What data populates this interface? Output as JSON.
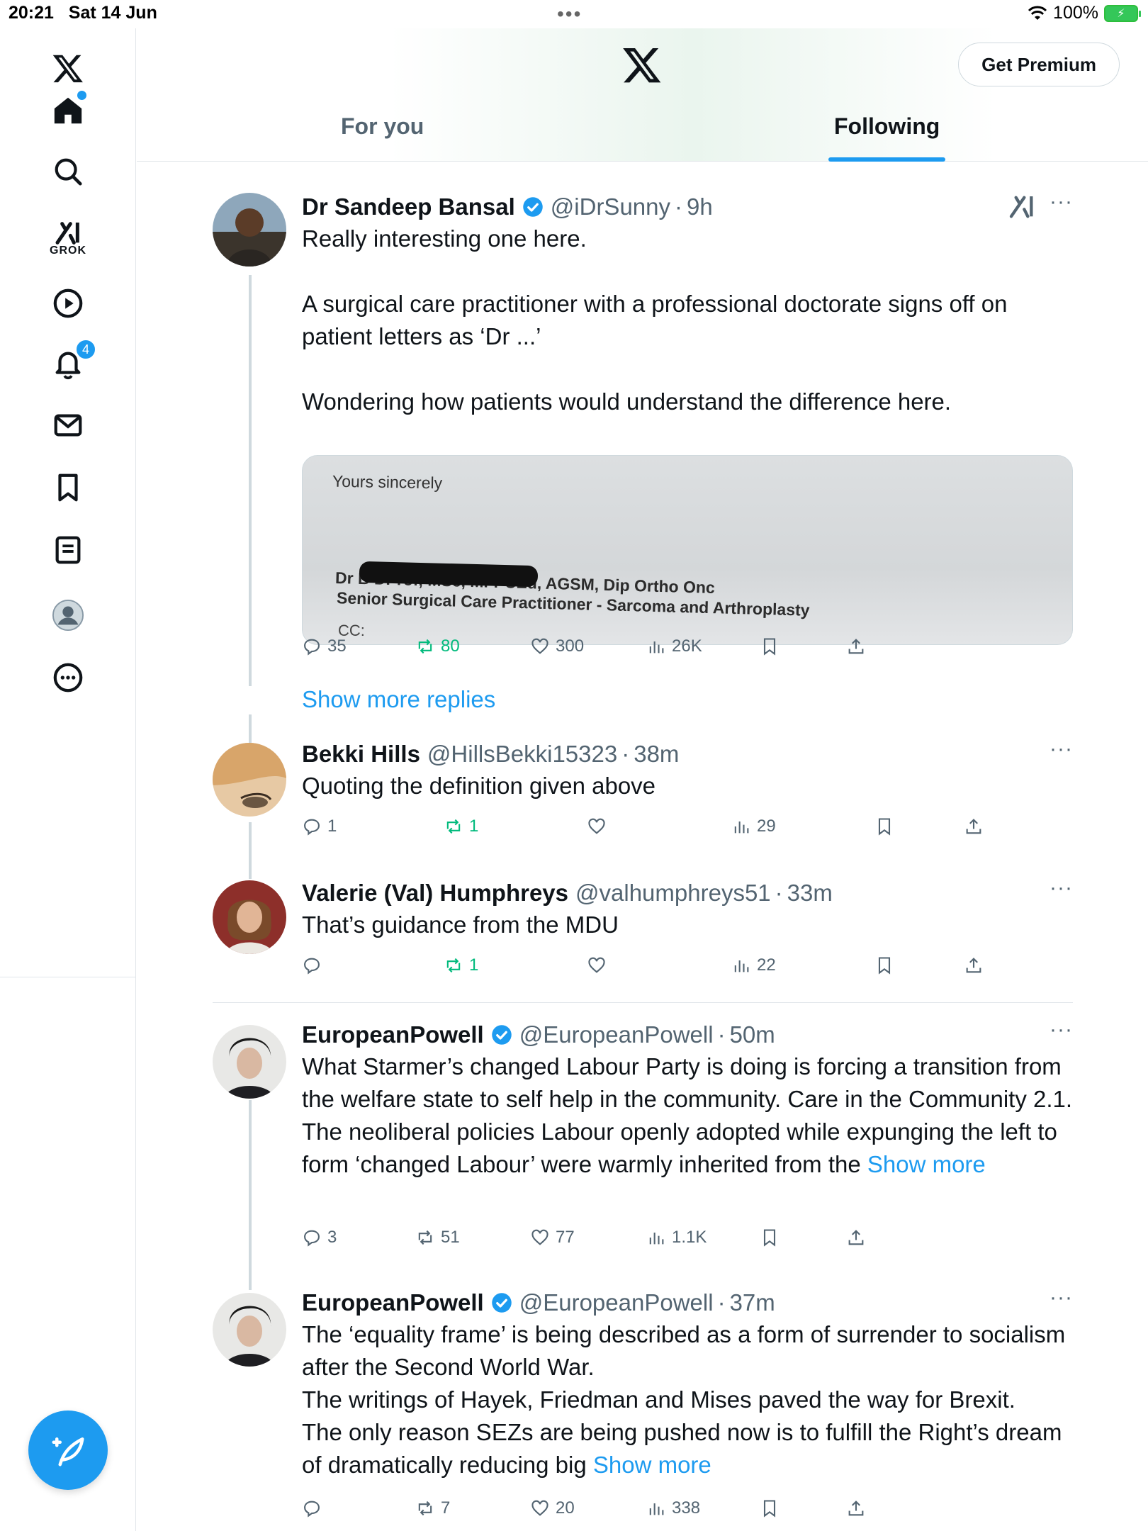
{
  "status": {
    "time": "20:21",
    "date": "Sat 14 Jun",
    "battery": "100%"
  },
  "sidebar": {
    "notifications_count": "4",
    "grok_label": "GROK"
  },
  "header": {
    "premium_label": "Get Premium",
    "tabs": [
      {
        "label": "For you",
        "active": false
      },
      {
        "label": "Following",
        "active": true
      }
    ]
  },
  "posts": [
    {
      "name": "Dr Sandeep Bansal",
      "handle": "@iDrSunny",
      "time": "9h",
      "verified": true,
      "text": "Really interesting one here.\n\nA surgical care practitioner with a professional doctorate signs off on patient letters as ‘Dr ...’\n\nWondering how patients would understand the difference here.",
      "media": {
        "line1": "Yours sincerely",
        "line2": "Dr B                                DProf, MSc, MFPCEd, AGSM, Dip Ortho Onc",
        "line3": "Senior Surgical Care Practitioner - Sarcoma and Arthroplasty",
        "line4": "CC:"
      },
      "replies": "35",
      "reposts": "80",
      "likes": "300",
      "views": "26K"
    },
    {
      "name": "Bekki Hills",
      "handle": "@HillsBekki15323",
      "time": "38m",
      "text": "Quoting the definition given above",
      "replies": "1",
      "reposts": "1",
      "likes": "",
      "views": "29"
    },
    {
      "name": "Valerie (Val) Humphreys",
      "handle": "@valhumphreys51",
      "time": "33m",
      "text": "That’s guidance from the MDU",
      "replies": "",
      "reposts": "1",
      "likes": "",
      "views": "22"
    },
    {
      "name": "EuropeanPowell",
      "handle": "@EuropeanPowell",
      "time": "50m",
      "verified": true,
      "text": "What Starmer’s changed Labour Party is doing is forcing a transition from the welfare state to self help in the community. Care in the Community 2.1.\nThe neoliberal policies Labour openly adopted while expunging the left to form ‘changed Labour’ were warmly inherited from the ",
      "show_more": "Show more",
      "replies": "3",
      "reposts": "51",
      "likes": "77",
      "views": "1.1K"
    },
    {
      "name": "EuropeanPowell",
      "handle": "@EuropeanPowell",
      "time": "37m",
      "verified": true,
      "text": "The ‘equality frame’ is being described as a form of surrender to socialism after the Second World War.\nThe writings of Hayek, Friedman and Mises paved the way for Brexit.\nThe only reason SEZs are being pushed now is to fulfill the Right’s dream of dramatically reducing big ",
      "show_more": "Show more",
      "replies": "",
      "reposts": "7",
      "likes": "20",
      "views": "338"
    }
  ],
  "show_more_replies": "Show more replies",
  "colors": {
    "accent": "#1d9bf0",
    "repost": "#00ba7c",
    "muted": "#536471"
  }
}
